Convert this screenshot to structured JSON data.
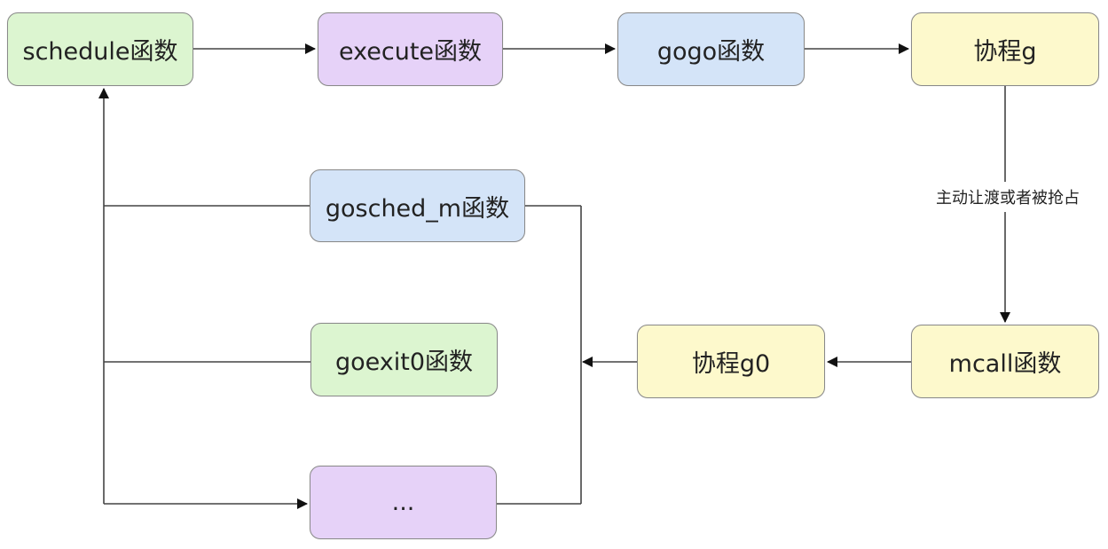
{
  "diagram": {
    "nodes": {
      "schedule": {
        "label": "schedule函数",
        "fill": "#dcf5d0"
      },
      "execute": {
        "label": "execute函数",
        "fill": "#e6d2f8"
      },
      "gogo": {
        "label": "gogo函数",
        "fill": "#d4e4f8"
      },
      "g": {
        "label": "协程g",
        "fill": "#fdf9cc"
      },
      "gosched": {
        "label": "gosched_m函数",
        "fill": "#d4e4f8"
      },
      "goexit": {
        "label": "goexit0函数",
        "fill": "#dcf5d0"
      },
      "g0": {
        "label": "协程g0",
        "fill": "#fdf9cc"
      },
      "mcall": {
        "label": "mcall函数",
        "fill": "#fdf9cc"
      },
      "more": {
        "label": "...",
        "fill": "#e6d2f8"
      }
    },
    "edge_labels": {
      "g_to_mcall": "主动让渡或者被抢占"
    },
    "edges": [
      {
        "from": "schedule",
        "to": "execute"
      },
      {
        "from": "execute",
        "to": "gogo"
      },
      {
        "from": "gogo",
        "to": "g"
      },
      {
        "from": "g",
        "to": "mcall"
      },
      {
        "from": "mcall",
        "to": "g0"
      },
      {
        "from": "g0",
        "to": "gosched"
      },
      {
        "from": "g0",
        "to": "goexit"
      },
      {
        "from": "g0",
        "to": "more"
      },
      {
        "from": "gosched",
        "to": "schedule"
      },
      {
        "from": "goexit",
        "to": "schedule"
      },
      {
        "from": "more",
        "to": "schedule"
      }
    ],
    "colors": {
      "line": "#444444",
      "border": "#8a8a8a"
    }
  }
}
